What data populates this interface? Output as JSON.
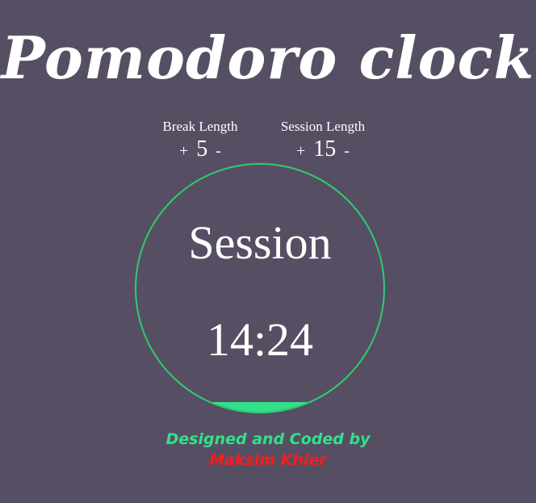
{
  "app": {
    "title": "Pomodoro clock"
  },
  "break": {
    "label": "Break Length",
    "plus": "+",
    "value": "5",
    "minus": "-"
  },
  "session": {
    "label": "Session Length",
    "plus": "+",
    "value": "15",
    "minus": "-"
  },
  "clock": {
    "mode": "Session",
    "time": "14:24",
    "progress_fraction": 0.04,
    "ring_color": "#2ecc71",
    "fill_color": "#33e08a"
  },
  "credits": {
    "line1": "Designed and Coded by",
    "author": "Maksim Khier",
    "line1_color": "#33e08a",
    "author_color": "#ff1a1a"
  },
  "colors": {
    "background": "#564f63",
    "text": "#ffffff"
  }
}
